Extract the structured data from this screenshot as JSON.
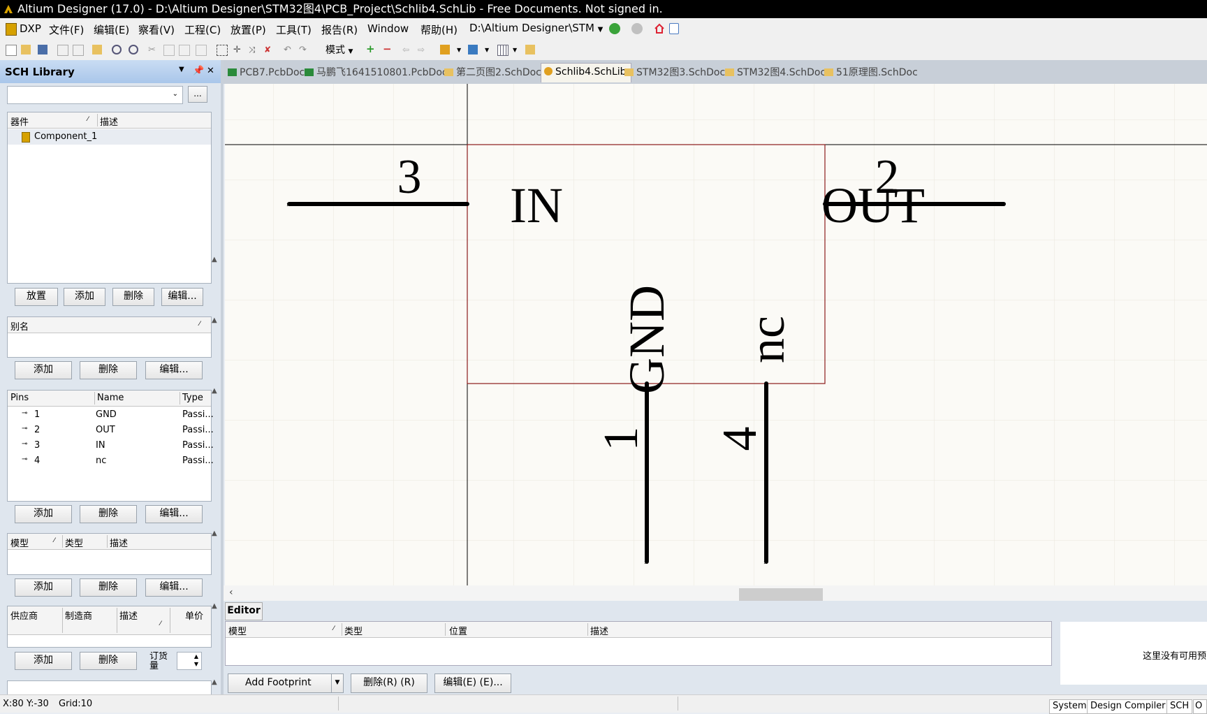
{
  "window": {
    "title": "Altium Designer (17.0) - D:\\Altium Designer\\STM32图4\\PCB_Project\\Schlib4.SchLib - Free Documents. Not signed in."
  },
  "menu": {
    "items": [
      "DXP",
      "文件(F)",
      "编辑(E)",
      "察看(V)",
      "工程(C)",
      "放置(P)",
      "工具(T)",
      "报告(R)",
      "Window",
      "帮助(H)"
    ],
    "path_combo": "D:\\Altium Designer\\STM"
  },
  "toolbar": {
    "mode_label": "模式"
  },
  "panel": {
    "title": "SCH Library",
    "filter_value": "",
    "browse_label": "...",
    "components": {
      "headers": [
        "器件",
        "描述"
      ],
      "rows": [
        "Component_1"
      ],
      "buttons": [
        "放置",
        "添加",
        "删除",
        "编辑..."
      ]
    },
    "aliases": {
      "header": "别名",
      "buttons": [
        "添加",
        "删除",
        "编辑..."
      ]
    },
    "pins": {
      "headers": [
        "Pins",
        "Name",
        "Type"
      ],
      "rows": [
        {
          "num": "1",
          "name": "GND",
          "type": "Passi..."
        },
        {
          "num": "2",
          "name": "OUT",
          "type": "Passi..."
        },
        {
          "num": "3",
          "name": "IN",
          "type": "Passi..."
        },
        {
          "num": "4",
          "name": "nc",
          "type": "Passi..."
        }
      ],
      "buttons": [
        "添加",
        "删除",
        "编辑..."
      ]
    },
    "models": {
      "headers": [
        "模型",
        "类型",
        "描述"
      ],
      "buttons": [
        "添加",
        "删除",
        "编辑..."
      ]
    },
    "suppliers": {
      "headers": [
        "供应商",
        "制造商",
        "描述",
        "单价"
      ],
      "buttons": [
        "添加",
        "删除"
      ],
      "order_label": "订货量"
    }
  },
  "tabs": [
    {
      "label": "PCB7.PcbDoc",
      "kind": "pcb"
    },
    {
      "label": "马鹏飞1641510801.PcbDoc",
      "kind": "pcb"
    },
    {
      "label": "第二页图2.SchDoc",
      "kind": "sch"
    },
    {
      "label": "Schlib4.SchLib",
      "kind": "lib",
      "active": true
    },
    {
      "label": "STM32图3.SchDoc",
      "kind": "sch"
    },
    {
      "label": "STM32图4.SchDoc",
      "kind": "sch"
    },
    {
      "label": "51原理图.SchDoc",
      "kind": "sch"
    }
  ],
  "schematic": {
    "pin_numbers": {
      "p1": "1",
      "p2": "2",
      "p3": "3",
      "p4": "4"
    },
    "pin_names": {
      "in": "IN",
      "out": "OUT",
      "gnd": "GND",
      "nc": "nc"
    }
  },
  "editor": {
    "tab_label": "Editor",
    "headers": [
      "模型",
      "类型",
      "位置",
      "描述"
    ],
    "add_footprint": "Add Footprint",
    "delete_btn": "删除(R) (R)",
    "edit_btn": "编辑(E) (E)...",
    "preview_text": "这里没有可用预"
  },
  "status": {
    "coords": "X:80 Y:-30",
    "grid": "Grid:10",
    "panels": [
      "System",
      "Design Compiler",
      "SCH",
      "O"
    ]
  },
  "colors": {
    "titlebar": "#000000",
    "panel_header": "#b8d0ee",
    "canvas": "#fbfaf6",
    "body_outline": "#8b1a1a"
  }
}
